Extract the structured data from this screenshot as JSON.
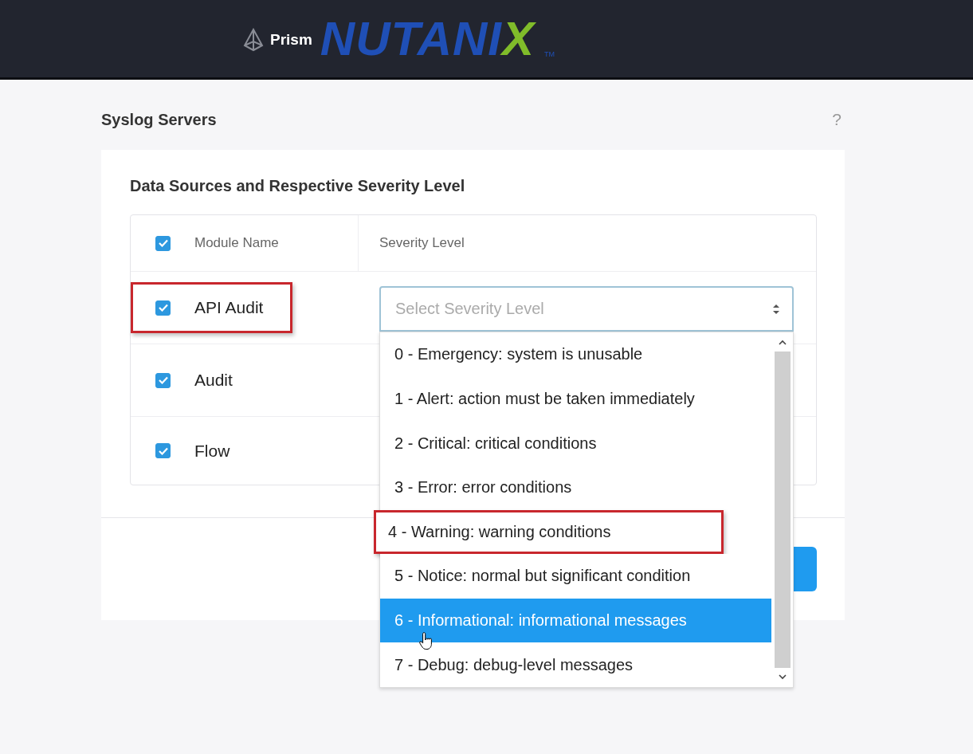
{
  "header": {
    "logo": {
      "wordmark": "NUTANIX",
      "mark": "TM",
      "product": "Prism"
    }
  },
  "page": {
    "title": "Syslog Servers",
    "help": "?"
  },
  "card": {
    "title": "Data Sources and Respective Severity Level",
    "table": {
      "columns": [
        {
          "label": "Module Name",
          "checked": true
        },
        {
          "label": "Severity Level"
        }
      ],
      "rows": [
        {
          "name": "API Audit",
          "checked": true,
          "annotated": true
        },
        {
          "name": "Audit",
          "checked": true,
          "annotated": false
        },
        {
          "name": "Flow",
          "checked": true,
          "annotated": false
        }
      ]
    },
    "severity_select": {
      "placeholder": "Select Severity Level",
      "expanded": true,
      "options": [
        {
          "label": "0 - Emergency: system is unusable",
          "selected": false,
          "annotated": false
        },
        {
          "label": "1 - Alert: action must be taken immediately",
          "selected": false,
          "annotated": false
        },
        {
          "label": "2 - Critical: critical conditions",
          "selected": false,
          "annotated": false
        },
        {
          "label": "3 - Error: error conditions",
          "selected": false,
          "annotated": false
        },
        {
          "label": "4 - Warning: warning conditions",
          "selected": false,
          "annotated": true
        },
        {
          "label": "5 - Notice: normal but significant condition",
          "selected": false,
          "annotated": false
        },
        {
          "label": "6 - Informational: informational messages",
          "selected": true,
          "annotated": false
        },
        {
          "label": "7 - Debug: debug-level messages",
          "selected": false,
          "annotated": false
        }
      ]
    }
  }
}
